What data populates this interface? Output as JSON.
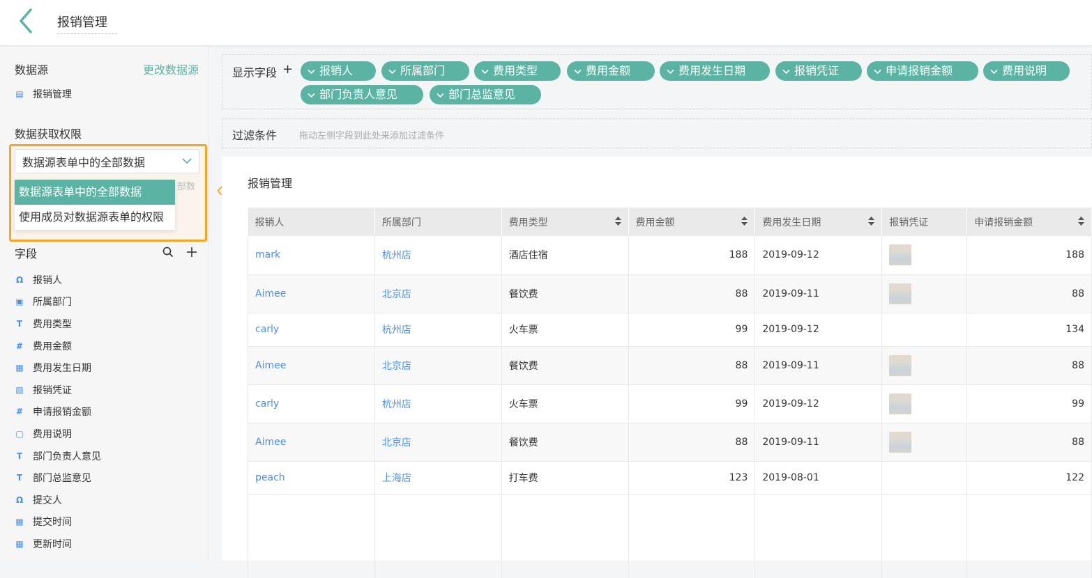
{
  "header": {
    "title": "报销管理"
  },
  "sidebar": {
    "datasource_title": "数据源",
    "change_datasource": "更改数据源",
    "datasource_item": "报销管理",
    "permission_title": "数据获取权限",
    "permission_selected": "数据源表单中的全部数据",
    "permission_options": [
      "数据源表单中的全部数据",
      "使用成员对数据源表单的权限"
    ],
    "permission_ghost": "部数",
    "fields_title": "字段",
    "fields": [
      {
        "label": "报销人",
        "icon": "user-icon",
        "glyph": "Ω"
      },
      {
        "label": "所属部门",
        "icon": "department-icon",
        "glyph": "▣"
      },
      {
        "label": "费用类型",
        "icon": "text-icon",
        "glyph": "T"
      },
      {
        "label": "费用金额",
        "icon": "number-icon",
        "glyph": "#"
      },
      {
        "label": "费用发生日期",
        "icon": "date-icon",
        "glyph": "▦"
      },
      {
        "label": "报销凭证",
        "icon": "image-icon",
        "glyph": "▧"
      },
      {
        "label": "申请报销金额",
        "icon": "number-icon",
        "glyph": "#"
      },
      {
        "label": "费用说明",
        "icon": "textarea-icon",
        "glyph": "▢"
      },
      {
        "label": "部门负责人意见",
        "icon": "text-icon",
        "glyph": "T"
      },
      {
        "label": "部门总监意见",
        "icon": "text-icon",
        "glyph": "T"
      },
      {
        "label": "提交人",
        "icon": "user-icon",
        "glyph": "Ω"
      },
      {
        "label": "提交时间",
        "icon": "date-icon",
        "glyph": "▦"
      },
      {
        "label": "更新时间",
        "icon": "date-icon",
        "glyph": "▦"
      }
    ]
  },
  "main": {
    "display_label": "显示字段",
    "display_chips": [
      "报销人",
      "所属部门",
      "费用类型",
      "费用金额",
      "费用发生日期",
      "报销凭证",
      "申请报销金额",
      "费用说明",
      "部门负责人意见",
      "部门总监意见"
    ],
    "filter_label": "过滤条件",
    "filter_hint": "拖动左侧字段到此处来添加过滤条件",
    "table_title": "报销管理",
    "columns": [
      "报销人",
      "所属部门",
      "费用类型",
      "费用金额",
      "费用发生日期",
      "报销凭证",
      "申请报销金额"
    ],
    "rows": [
      {
        "person": "mark",
        "dept": "杭州店",
        "type": "酒店住宿",
        "amount": "188",
        "date": "2019-09-12",
        "voucher": true,
        "apply": "188"
      },
      {
        "person": "Aimee",
        "dept": "北京店",
        "type": "餐饮费",
        "amount": "88",
        "date": "2019-09-11",
        "voucher": true,
        "apply": "88"
      },
      {
        "person": "carly",
        "dept": "杭州店",
        "type": "火车票",
        "amount": "99",
        "date": "2019-09-12",
        "voucher": false,
        "apply": "134"
      },
      {
        "person": "Aimee",
        "dept": "北京店",
        "type": "餐饮费",
        "amount": "88",
        "date": "2019-09-11",
        "voucher": true,
        "apply": "88"
      },
      {
        "person": "carly",
        "dept": "杭州店",
        "type": "火车票",
        "amount": "99",
        "date": "2019-09-12",
        "voucher": true,
        "apply": "99"
      },
      {
        "person": "Aimee",
        "dept": "北京店",
        "type": "餐饮费",
        "amount": "88",
        "date": "2019-09-11",
        "voucher": true,
        "apply": "88"
      },
      {
        "person": "peach",
        "dept": "上海店",
        "type": "打车费",
        "amount": "123",
        "date": "2019-08-01",
        "voucher": false,
        "apply": "122"
      }
    ]
  },
  "colors": {
    "accent": "#5bb3a3",
    "link": "#4a90e2",
    "highlight": "#f5a623"
  }
}
